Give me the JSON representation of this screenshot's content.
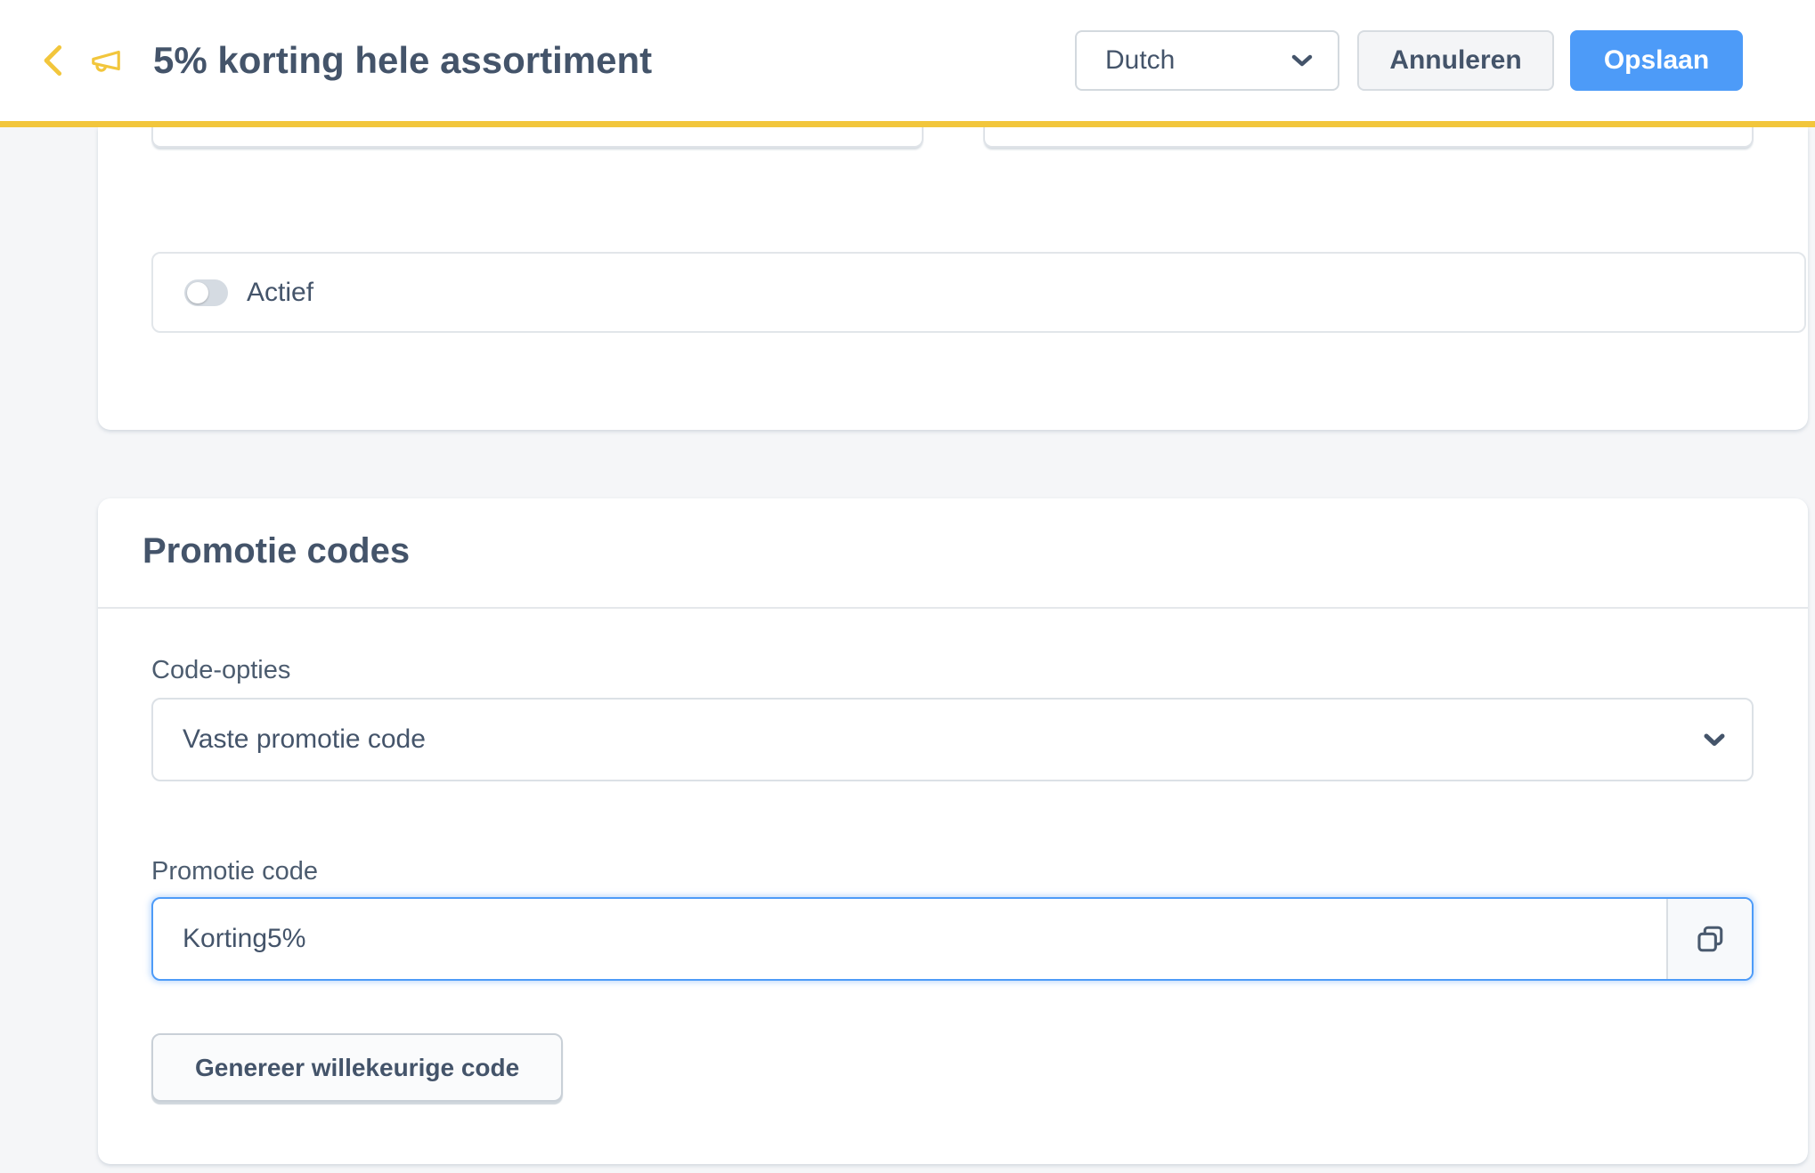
{
  "header": {
    "title": "5% korting hele assortiment",
    "back_icon": "chevron-left",
    "promo_icon": "megaphone",
    "language_select": {
      "value": "Dutch",
      "chevron_icon": "chevron-down"
    },
    "cancel_label": "Annuleren",
    "save_label": "Opslaan"
  },
  "settings_card": {
    "active_toggle": {
      "label": "Actief",
      "state": "off"
    }
  },
  "promo_card": {
    "title": "Promotie codes",
    "code_options": {
      "label": "Code-opties",
      "value": "Vaste promotie code",
      "chevron_icon": "chevron-down"
    },
    "promo_code": {
      "label": "Promotie code",
      "value": "Korting5%",
      "copy_icon": "copy"
    },
    "generate_button_label": "Genereer willekeurige code"
  },
  "colors": {
    "accent_yellow": "#F2C63C",
    "primary_blue": "#4D9BF8",
    "ink_slate": "#44546A",
    "page_background": "#F5F6F8"
  }
}
